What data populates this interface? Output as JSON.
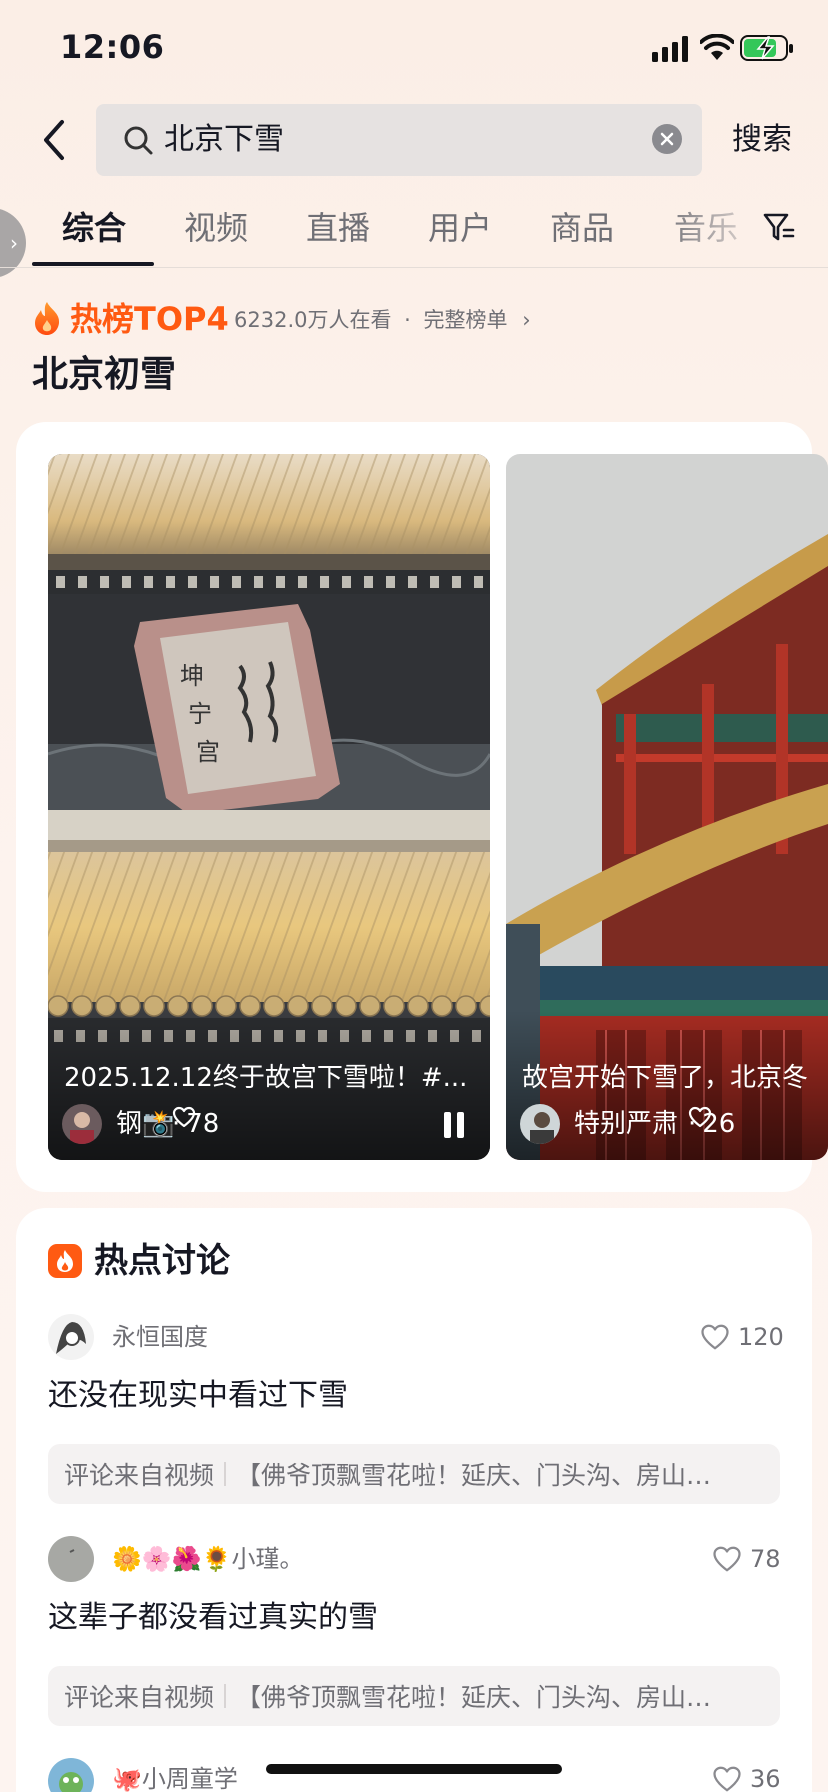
{
  "status_bar": {
    "time": "12:06"
  },
  "search": {
    "query": "北京下雪",
    "button": "搜索"
  },
  "tabs": [
    {
      "label": "综合",
      "active": true
    },
    {
      "label": "视频"
    },
    {
      "label": "直播"
    },
    {
      "label": "用户"
    },
    {
      "label": "商品"
    },
    {
      "label": "音乐"
    }
  ],
  "hot_rank": {
    "label": "热榜TOP4",
    "viewers": "6232.0万人在看",
    "separator": "·",
    "full_list": "完整榜单",
    "topic": "北京初雪"
  },
  "videos": [
    {
      "caption": "2025.12.12终于故宫下雪啦！#...",
      "author": "钢📸",
      "dot": "·",
      "likes": "78"
    },
    {
      "caption": "故宫开始下雪了，北京冬",
      "author": "特别严肃",
      "dot": "·",
      "likes": "26"
    }
  ],
  "discussion": {
    "title": "热点讨论",
    "comments": [
      {
        "user": "永恒国度",
        "likes": "120",
        "text": "还没在现实中看过下雪",
        "source_label": "评论来自视频",
        "source_title": "【佛爷顶飘雪花啦！延庆、门头沟、房山…"
      },
      {
        "user": "🌼🌸🌺🌻小瑾。",
        "likes": "78",
        "text": "这辈子都没看过真实的雪",
        "source_label": "评论来自视频",
        "source_title": "【佛爷顶飘雪花啦！延庆、门头沟、房山…"
      },
      {
        "user": "🐙小周童学",
        "likes": "36"
      }
    ]
  },
  "colors": {
    "accent": "#ff5a12",
    "text": "#161823",
    "muted": "#6f6f75"
  }
}
